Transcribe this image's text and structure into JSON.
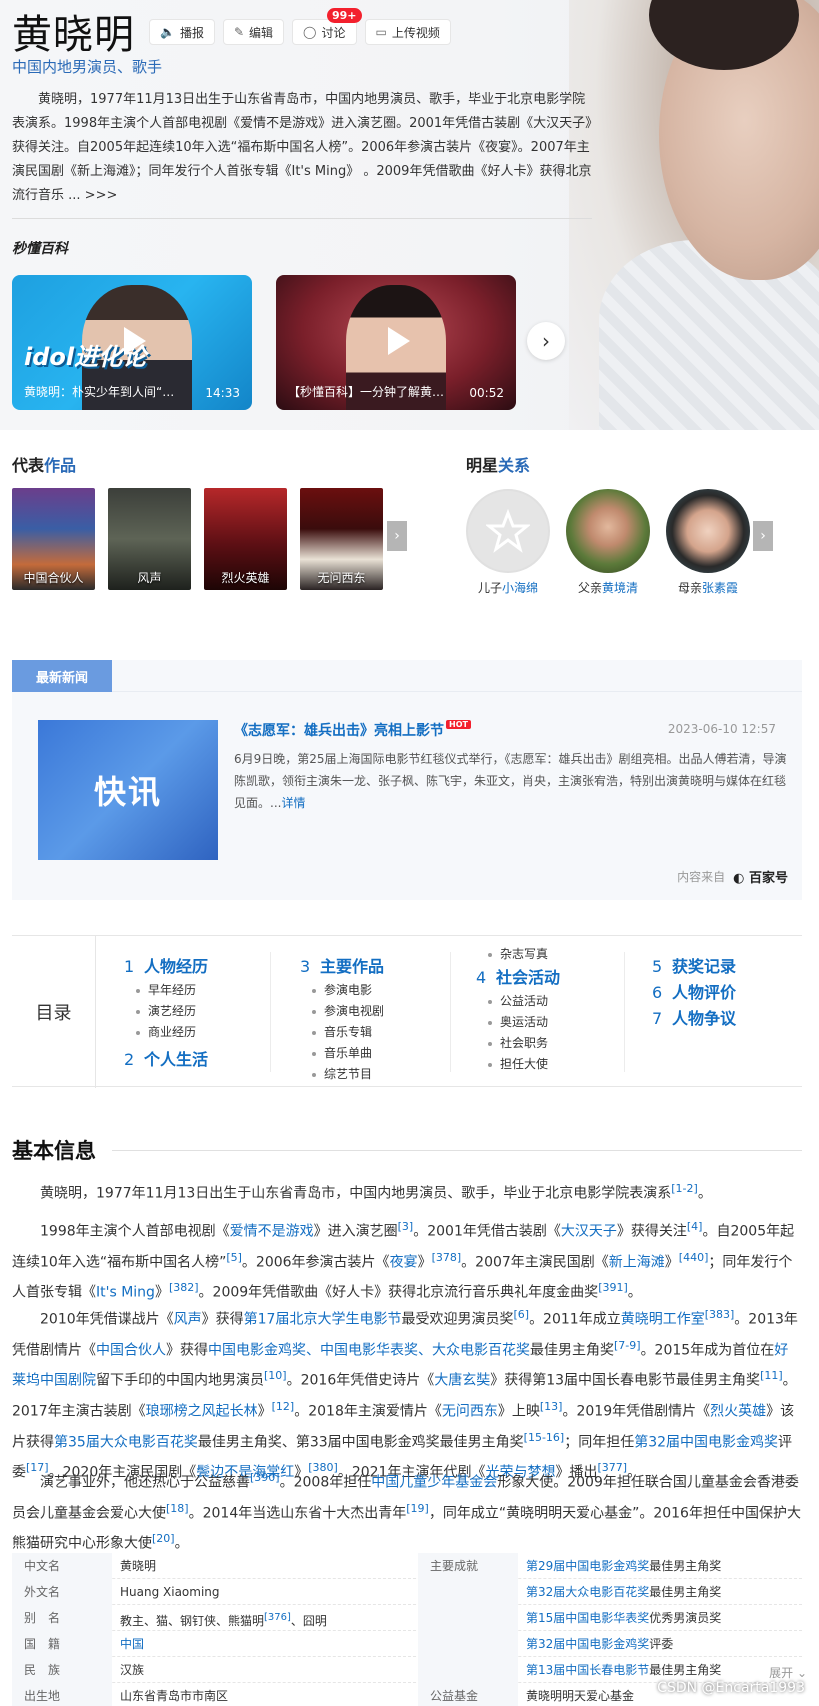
{
  "header": {
    "name": "黄晓明",
    "subtitle": "中国内地男演员、歌手",
    "tools": [
      {
        "label": "播报"
      },
      {
        "label": "编辑"
      },
      {
        "label": "讨论",
        "badge": "99+"
      },
      {
        "label": "上传视频"
      }
    ],
    "summary": "黄晓明，1977年11月13日出生于山东省青岛市，中国内地男演员、歌手，毕业于北京电影学院表演系。1998年主演个人首部电视剧《爱情不是游戏》进入演艺圈。2001年凭借古装剧《大汉天子》获得关注。自2005年起连续10年入选“福布斯中国名人榜”。2006年参演古装片《夜宴》。2007年主演民国剧《新上海滩》；同年发行个人首张专辑《It's Ming》 。2009年凭借歌曲《好人卡》获得北京流行音乐",
    "summary_more": "... >>>",
    "brand": "秒懂百科"
  },
  "videos": [
    {
      "tag": "idol进化论",
      "caption": "黄晓明：朴实少年到人间“油”...",
      "duration": "14:33"
    },
    {
      "caption": "【秒懂百科】一分钟了解黄晓明",
      "duration": "00:52"
    }
  ],
  "works": {
    "title_prefix": "代表",
    "title_highlight": "作品",
    "items": [
      "中国合伙人",
      "风声",
      "烈火英雄",
      "无问西东"
    ]
  },
  "relations": {
    "title_prefix": "明星",
    "title_highlight": "关系",
    "items": [
      {
        "role": "儿子",
        "name": "小海绵"
      },
      {
        "role": "父亲",
        "name": "黄境清"
      },
      {
        "role": "母亲",
        "name": "张素霞"
      }
    ]
  },
  "news": {
    "tab": "最新新闻",
    "thumb": "快讯",
    "headline": "《志愿军：雄兵出击》亮相上影节",
    "hot": "HOT",
    "date": "2023-06-10 12:57",
    "body": "6月9日晚，第25届上海国际电影节红毯仪式举行，《志愿军：雄兵出击》剧组亮相。出品人傅若清，导演陈凯歌，领衔主演朱一龙、张子枫、陈飞宇，朱亚文，肖央，主演张宥浩，特别出演黄晓明与媒体在红毯见面。...",
    "more": "详情",
    "source_label": "内容来自",
    "source": "百家号"
  },
  "toc": {
    "label": "目录",
    "col1": [
      {
        "num": "1",
        "title": "人物经历",
        "subs": [
          "早年经历",
          "演艺经历",
          "商业经历"
        ]
      },
      {
        "num": "2",
        "title": "个人生活",
        "subs": []
      }
    ],
    "col2": [
      {
        "num": "3",
        "title": "主要作品",
        "subs": [
          "参演电影",
          "参演电视剧",
          "音乐专辑",
          "音乐单曲",
          "综艺节目"
        ]
      }
    ],
    "col3_pre": [
      "杂志写真"
    ],
    "col3": [
      {
        "num": "4",
        "title": "社会活动",
        "subs": [
          "公益活动",
          "奥运活动",
          "社会职务",
          "担任大使"
        ]
      }
    ],
    "col4": [
      {
        "num": "5",
        "title": "获奖记录"
      },
      {
        "num": "6",
        "title": "人物评价"
      },
      {
        "num": "7",
        "title": "人物争议"
      }
    ]
  },
  "basic": {
    "title": "基本信息",
    "p1": "黄晓明，1977年11月13日出生于山东省青岛市，中国内地男演员、歌手，毕业于北京电影学院表演系",
    "p1_ref": "[1-2]",
    "p2": {
      "a": "1998年主演个人首部电视剧《",
      "l1": "爱情不是游戏",
      "b": "》进入演艺圈",
      "r1": "[3]",
      "c": "。2001年凭借古装剧《",
      "l2": "大汉天子",
      "d": "》获得关注",
      "r2": "[4]",
      "e": "。自2005年起连续10年入选“福布斯中国名人榜”",
      "r3": "[5]",
      "f": "。2006年参演古装片《",
      "l3": "夜宴",
      "g": "》",
      "r4": "[378]",
      "h": "。2007年主演民国剧《",
      "l4": "新上海滩",
      "i": "》",
      "r5": "[440]",
      "j": "；同年发行个人首张专辑《",
      "l5": "It's Ming",
      "k": "》",
      "r6": "[382]",
      "m": "。2009年凭借歌曲《好人卡》获得北京流行音乐典礼年度金曲奖",
      "r7": "[391]",
      "n": "。"
    },
    "p3": {
      "a": "2010年凭借谍战片《",
      "l1": "风声",
      "b": "》获得",
      "l2": "第17届北京大学生电影节",
      "c": "最受欢迎男演员奖",
      "r1": "[6]",
      "d": "。2011年成立",
      "l3": "黄晓明工作室",
      "r2": "[383]",
      "e": "。2013年凭借剧情片《",
      "l4": "中国合伙人",
      "f": "》获得",
      "l5": "中国电影金鸡奖、中国电影华表奖、大众电影百花奖",
      "g": "最佳男主角奖",
      "r3": "[7-9]",
      "h": "。2015年成为首位在",
      "l6": "好莱坞中国剧院",
      "i": "留下手印的中国内地男演员",
      "r4": "[10]",
      "j": "。2016年凭借史诗片《",
      "l7": "大唐玄奘",
      "k": "》获得第13届中国长春电影节最佳男主角奖",
      "r5": "[11]",
      "m": "。2017年主演古装剧《",
      "l8": "琅琊榜之风起长林",
      "n": "》",
      "r6": "[12]",
      "o": "。2018年主演爱情片《",
      "l9": "无问西东",
      "p": "》上映",
      "r7": "[13]",
      "q": "。2019年凭借剧情片《",
      "l10": "烈火英雄",
      "s": "》该片获得",
      "l11": "第35届大众电影百花奖",
      "t": "最佳男主角奖、第33届中国电影金鸡奖最佳男主角奖",
      "r8": "[15-16]",
      "u": "；同年担任",
      "l12": "第32届中国电影金鸡奖",
      "v": "评委",
      "r9": "[17]",
      "w": "。2020年主演民国剧《",
      "l13": "鬓边不是海棠红",
      "x": "》",
      "r10": "[380]",
      "y": "。2021年主演年代剧《",
      "l14": "光荣与梦想",
      "z": "》播出",
      "r11": "[377]",
      "end": "。"
    },
    "p4": {
      "a": "演艺事业外，他还热心于公益慈善",
      "r1": "[390]",
      "b": "。2008年担任",
      "l1": "中国儿童少年基金会",
      "c": "形象大使。2009年担任联合国儿童基金会香港委员会儿童基金会爱心大使",
      "r2": "[18]",
      "d": "。2014年当选山东省十大杰出青年",
      "r3": "[19]",
      "e": "，同年成立“黄晓明明天爱心基金”。2016年担任中国保护大熊猫研究中心形象大使",
      "r4": "[20]",
      "end": "。"
    }
  },
  "info": [
    {
      "k": "中文名",
      "v": "黄晓明",
      "k2": "主要成就",
      "v2_link": "第29届中国电影金鸡奖",
      "v2": "最佳男主角奖"
    },
    {
      "k": "外文名",
      "v": "Huang Xiaoming",
      "k2": "",
      "v2_link": "第32届大众电影百花奖",
      "v2": "最佳男主角奖"
    },
    {
      "k": "别　名",
      "v": "教主、猫、钢钉侠、熊猫明",
      "v_ref": "[376]",
      "v_tail": "、囧明",
      "k2": "",
      "v2_link": "第15届中国电影华表奖",
      "v2": "优秀男演员奖"
    },
    {
      "k": "国　籍",
      "v_link": "中国",
      "k2": "",
      "v2_link": "第32届中国电影金鸡奖",
      "v2": "评委"
    },
    {
      "k": "民　族",
      "v": "汉族",
      "k2": "",
      "v2_link": "第13届中国长春电影节",
      "v2": "最佳男主角奖"
    },
    {
      "k": "出生地",
      "v": "山东省青岛市市南区",
      "k2": "公益基金",
      "v2": "黄晓明明天爱心基金"
    }
  ],
  "expand": "展开 ⌄",
  "watermark": "CSDN @Encarta1993"
}
